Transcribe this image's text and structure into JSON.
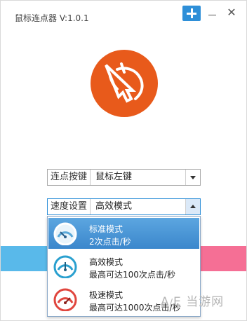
{
  "window": {
    "title": "鼠标连点器 V:1.0.1"
  },
  "click_button": {
    "label": "连点按键",
    "value": "鼠标左键"
  },
  "speed_setting": {
    "label": "速度设置",
    "value": "高效模式"
  },
  "speed_options": [
    {
      "name": "标准模式",
      "desc": "2次点击/秒",
      "selected": true,
      "color": "#4a9fd8"
    },
    {
      "name": "高效模式",
      "desc": "最高可达100次点击/秒",
      "selected": false,
      "color": "#2aa0cf"
    },
    {
      "name": "极速模式",
      "desc": "最高可达1000次点击/秒",
      "selected": false,
      "color": "#e0463e"
    }
  ],
  "logo": {
    "color": "#e85a1b",
    "icon": "mouse-icon"
  },
  "watermark": "当游网",
  "colors": {
    "accent": "#2e8fd8",
    "bar_left": "#59b9ea",
    "bar_right": "#f56f95"
  }
}
